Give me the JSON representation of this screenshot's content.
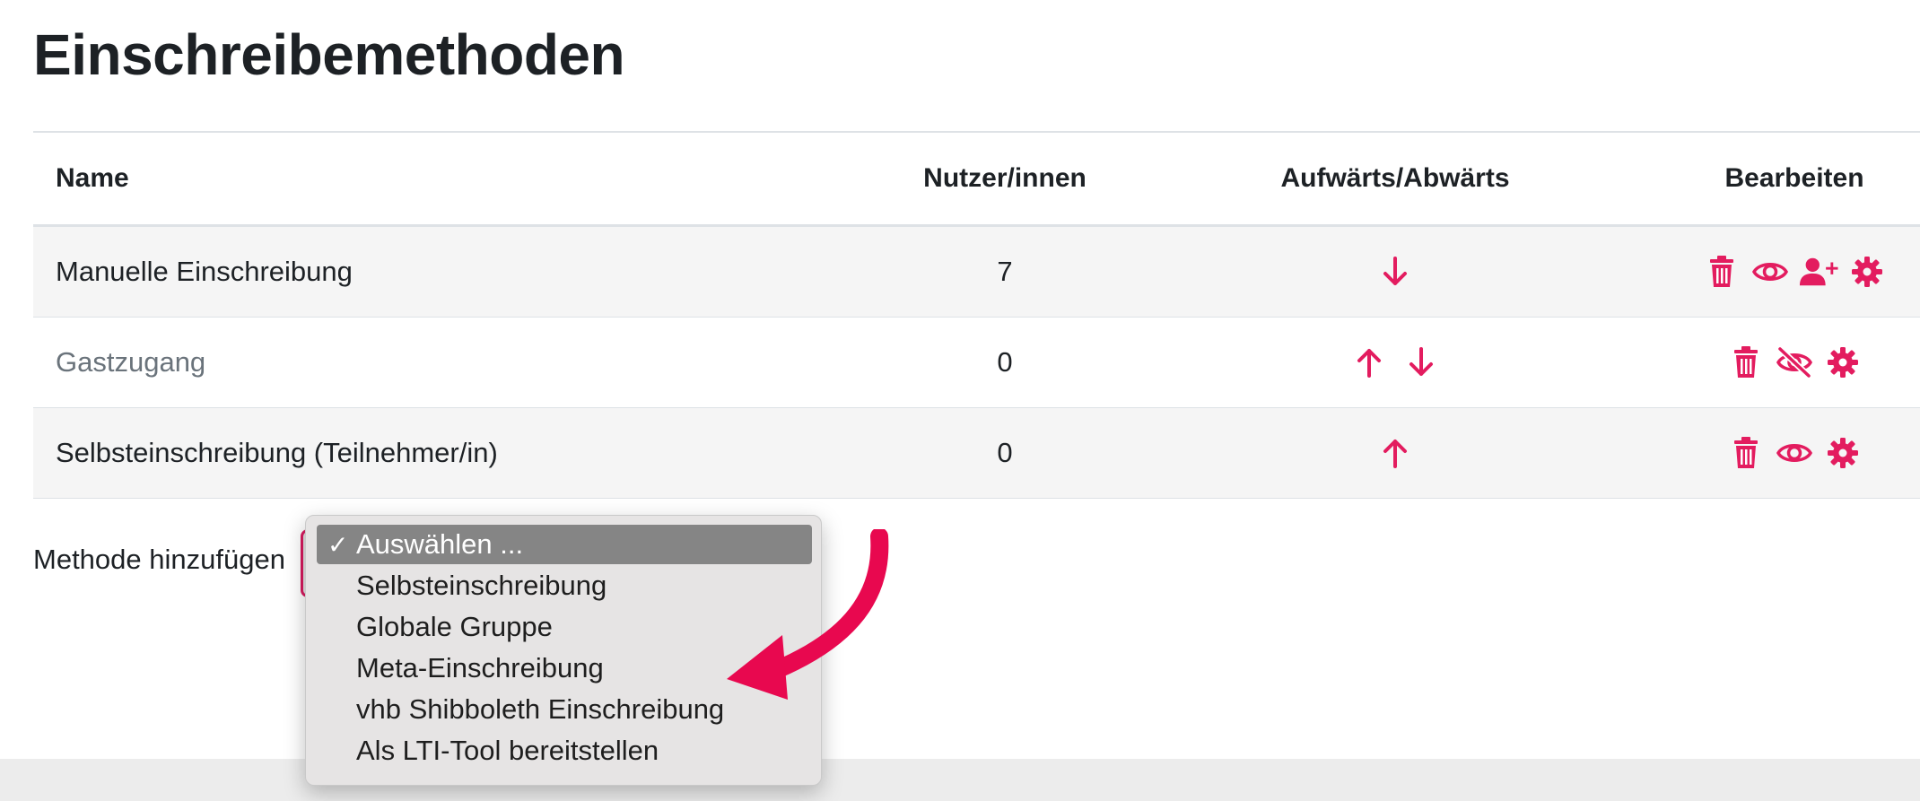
{
  "page": {
    "title": "Einschreibemethoden"
  },
  "colors": {
    "accent": "#e31c5f",
    "muted_text": "#6a737b",
    "selected_option_bg": "#858585"
  },
  "table": {
    "headers": {
      "name": "Name",
      "users": "Nutzer/innen",
      "move": "Aufwärts/Abwärts",
      "edit": "Bearbeiten"
    },
    "rows": [
      {
        "name": "Manuelle Einschreibung",
        "users": "7",
        "move": [
          "down-arrow-icon"
        ],
        "edit": [
          "trash-icon",
          "eye-icon",
          "add-user-icon",
          "gear-icon"
        ],
        "disabled": false
      },
      {
        "name": "Gastzugang",
        "users": "0",
        "move": [
          "up-arrow-icon",
          "down-arrow-icon"
        ],
        "edit": [
          "trash-icon",
          "eye-slash-icon",
          "gear-icon"
        ],
        "disabled": true
      },
      {
        "name": "Selbsteinschreibung (Teilnehmer/in)",
        "users": "0",
        "move": [
          "up-arrow-icon"
        ],
        "edit": [
          "trash-icon",
          "eye-icon",
          "gear-icon"
        ],
        "disabled": false
      }
    ]
  },
  "add_method": {
    "label": "Methode hinzufügen",
    "options": [
      "Auswählen ...",
      "Selbsteinschreibung",
      "Globale Gruppe",
      "Meta-Einschreibung",
      "vhb Shibboleth Einschreibung",
      "Als LTI-Tool bereitstellen"
    ],
    "selected_check": "✓"
  }
}
